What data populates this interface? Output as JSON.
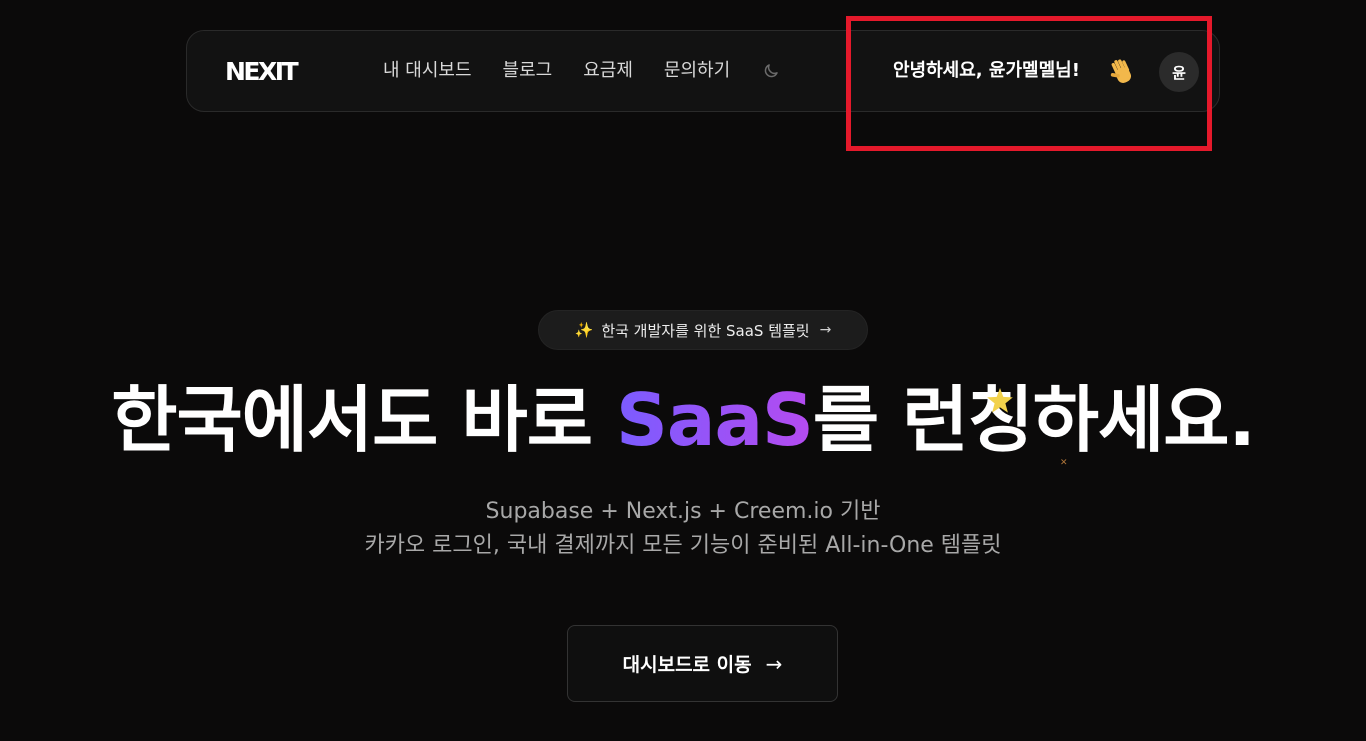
{
  "nav": {
    "logo": "NEXIT",
    "links": [
      "내 대시보드",
      "블로그",
      "요금제",
      "문의하기"
    ],
    "theme_icon": "moon-icon",
    "greeting": "안녕하세요, 윤가멜멜님!",
    "wave_icon": "waving-hand-icon",
    "avatar_initial": "윤"
  },
  "hero": {
    "badge_text": "한국 개발자를 위한 SaaS 템플릿",
    "badge_arrow": "→",
    "headline_part1": "한국에서도 바로 ",
    "headline_accent": "SaaS",
    "headline_part2": "를 ",
    "headline_launch": "런칭",
    "headline_part3": "하세요.",
    "subtitle_line1": "Supabase + Next.js + Creem.io 기반",
    "subtitle_line2": "카카오 로그인, 국내 결제까지 모든 기능이 준비된 All-in-One 템플릿",
    "cta_label": "대시보드로 이동",
    "cta_arrow": "→"
  },
  "colors": {
    "background": "#0b0a0a",
    "accent_start": "#7b5cff",
    "accent_end": "#b54bf0",
    "highlight_box": "#e5192b"
  }
}
